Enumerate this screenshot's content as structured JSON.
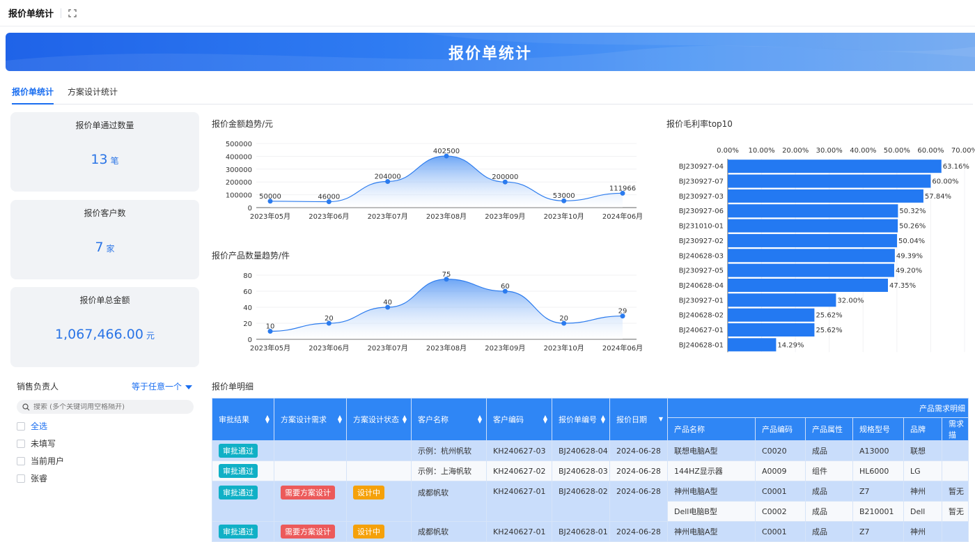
{
  "topbar": {
    "title": "报价单统计"
  },
  "banner": {
    "title": "报价单统计"
  },
  "tabs": [
    "报价单统计",
    "方案设计统计"
  ],
  "cards": [
    {
      "label": "报价单通过数量",
      "value": "13",
      "unit": "笔"
    },
    {
      "label": "报价客户数",
      "value": "7",
      "unit": "家"
    },
    {
      "label": "报价单总金额",
      "value": "1,067,466.00",
      "unit": "元"
    }
  ],
  "filter": {
    "label": "销售负责人",
    "operator": "等于任意一个",
    "search_placeholder": "搜索 (多个关键词用空格隔开)",
    "options": [
      "全选",
      "未填写",
      "当前用户",
      "张睿"
    ]
  },
  "sections": {
    "amount_trend": "报价金额趋势/元",
    "product_trend": "报价产品数量趋势/件",
    "margin_top10": "报价毛利率top10",
    "detail": "报价单明细"
  },
  "chart_data": [
    {
      "type": "area",
      "title": "报价金额趋势/元",
      "categories": [
        "2023年05月",
        "2023年06月",
        "2023年07月",
        "2023年08月",
        "2023年09月",
        "2023年10月",
        "2024年06月"
      ],
      "values": [
        50000,
        46000,
        204000,
        402500,
        200000,
        53000,
        111966
      ],
      "yticks": [
        "0",
        "100000",
        "200000",
        "300000",
        "400000",
        "500000"
      ],
      "ylim": [
        0,
        500000
      ]
    },
    {
      "type": "area",
      "title": "报价产品数量趋势/件",
      "categories": [
        "2023年05月",
        "2023年06月",
        "2023年07月",
        "2023年08月",
        "2023年09月",
        "2023年10月",
        "2024年06月"
      ],
      "values": [
        10,
        20,
        40,
        75,
        60,
        20,
        29
      ],
      "yticks": [
        "0",
        "20",
        "40",
        "60",
        "80"
      ],
      "ylim": [
        0,
        80
      ]
    },
    {
      "type": "bar",
      "orientation": "horizontal",
      "title": "报价毛利率top10",
      "categories": [
        "BJ230927-04",
        "BJ230927-07",
        "BJ230927-03",
        "BJ230927-06",
        "BJ231010-01",
        "BJ230927-02",
        "BJ240628-03",
        "BJ230927-05",
        "BJ240628-04",
        "BJ230927-01",
        "BJ240628-02",
        "BJ240627-01",
        "BJ240628-01"
      ],
      "values": [
        63.16,
        60.0,
        57.84,
        50.32,
        50.26,
        50.04,
        49.39,
        49.2,
        47.35,
        32.0,
        25.62,
        25.62,
        14.29
      ],
      "labels": [
        "63.16%",
        "60.00%",
        "57.84%",
        "50.32%",
        "50.26%",
        "50.04%",
        "49.39%",
        "49.20%",
        "47.35%",
        "32.00%",
        "25.62%",
        "25.62%",
        "14.29%"
      ],
      "xticks": [
        "0.00%",
        "10.00%",
        "20.00%",
        "30.00%",
        "40.00%",
        "50.00%",
        "60.00%",
        "70.00%"
      ],
      "xlim": [
        0,
        70
      ]
    }
  ],
  "table": {
    "headers": [
      "审批结果",
      "方案设计需求",
      "方案设计状态",
      "客户名称",
      "客户编码",
      "报价单编号",
      "报价日期"
    ],
    "group_header": "产品需求明细",
    "sub_headers": [
      "产品名称",
      "产品编码",
      "产品属性",
      "规格型号",
      "品牌",
      "需求描"
    ],
    "rows": [
      {
        "approval": "审批通过",
        "design_need": "",
        "design_status": "",
        "customer": "示例：杭州帆软",
        "cust_code": "KH240627-03",
        "quote_no": "BJ240628-04",
        "date": "2024-06-28",
        "product": "联想电脑A型",
        "prod_code": "C0020",
        "attr": "成品",
        "spec": "A13000",
        "brand": "联想",
        "desc": ""
      },
      {
        "approval": "审批通过",
        "design_need": "",
        "design_status": "",
        "customer": "示例：上海帆软",
        "cust_code": "KH240627-02",
        "quote_no": "BJ240628-03",
        "date": "2024-06-28",
        "product": "144HZ显示器",
        "prod_code": "A0009",
        "attr": "组件",
        "spec": "HL6000",
        "brand": "LG",
        "desc": ""
      },
      {
        "approval": "审批通过",
        "design_need": "需要方案设计",
        "design_status": "设计中",
        "customer": "成都帆软",
        "cust_code": "KH240627-01",
        "quote_no": "BJ240628-02",
        "date": "2024-06-28",
        "product": "神州电脑A型",
        "prod_code": "C0001",
        "attr": "成品",
        "spec": "Z7",
        "brand": "神州",
        "desc": "暂无"
      },
      {
        "approval": "",
        "design_need": "",
        "design_status": "",
        "customer": "",
        "cust_code": "",
        "quote_no": "",
        "date": "",
        "product": "Dell电脑B型",
        "prod_code": "C0002",
        "attr": "成品",
        "spec": "B210001",
        "brand": "Dell",
        "desc": "暂无"
      },
      {
        "approval": "审批通过",
        "design_need": "需要方案设计",
        "design_status": "设计中",
        "customer": "成都帆软",
        "cust_code": "KH240627-01",
        "quote_no": "BJ240628-01",
        "date": "2024-06-28",
        "product": "神州电脑A型",
        "prod_code": "C0001",
        "attr": "成品",
        "spec": "Z7",
        "brand": "神州",
        "desc": ""
      }
    ]
  },
  "colors": {
    "accent": "#1a6ef0",
    "bar": "#2379f2",
    "header": "#2f86f5"
  }
}
